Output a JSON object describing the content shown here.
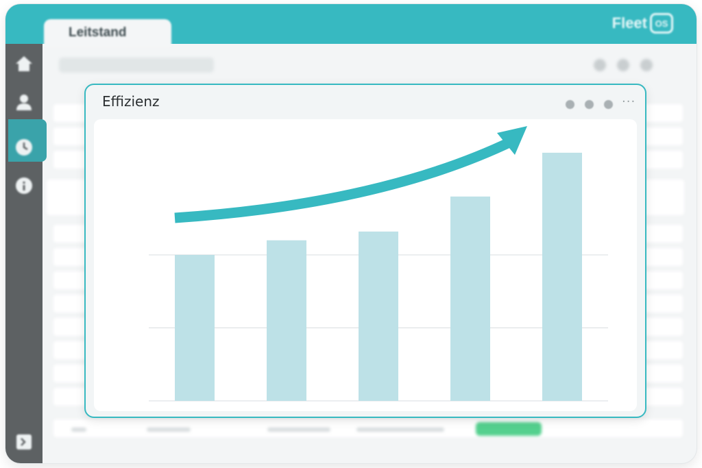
{
  "window": {
    "tab_label": "Leitstand",
    "brand_word": "Fleet",
    "brand_badge": "OS"
  },
  "colors": {
    "accent": "#37b9c1",
    "bar": "#bde1e7",
    "sidebar": "#5d6163",
    "status_green": "#54d08e"
  },
  "sidebar": {
    "items": [
      {
        "icon": "home-icon"
      },
      {
        "icon": "user-icon",
        "active": true
      },
      {
        "icon": "clock-icon"
      },
      {
        "icon": "info-icon"
      },
      {
        "icon": "logout-icon"
      }
    ]
  },
  "card": {
    "title": "Effizienz",
    "more": "···"
  },
  "chart_data": {
    "type": "bar",
    "title": "Effizienz",
    "categories": [
      "",
      "",
      "",
      "",
      ""
    ],
    "values": [
      50,
      55,
      58,
      70,
      85
    ],
    "ylim": [
      0,
      100
    ],
    "grid": true,
    "trend_arrow": "increasing"
  }
}
